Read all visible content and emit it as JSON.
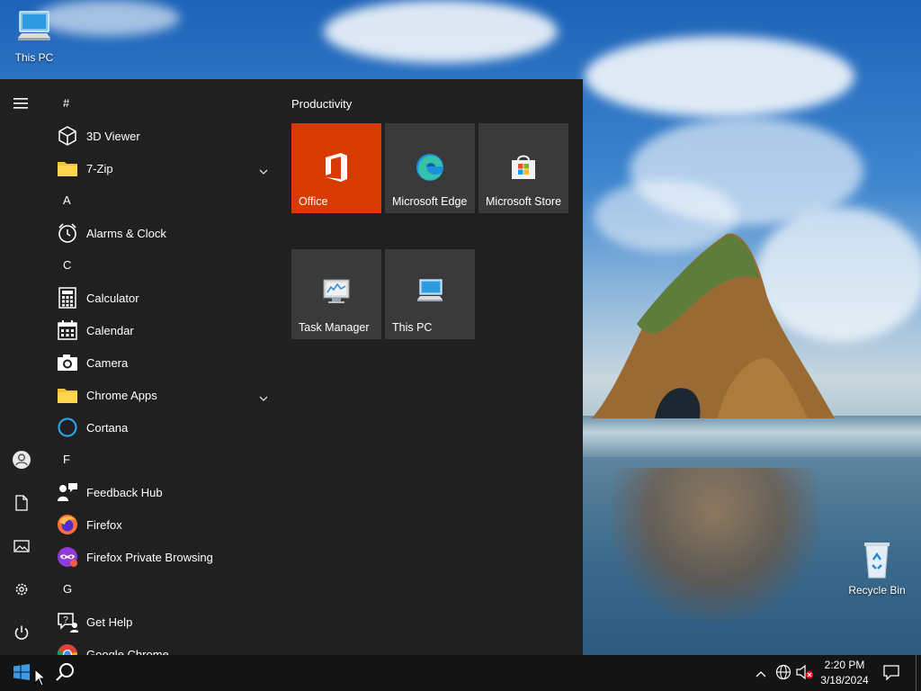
{
  "desktop": {
    "icons": [
      {
        "label": "This PC",
        "icon": "this-pc-icon"
      },
      {
        "label": "Recycle Bin",
        "icon": "recycle-bin-icon"
      }
    ]
  },
  "start_menu": {
    "rail": [
      "menu-icon",
      "user-icon",
      "documents-icon",
      "pictures-icon",
      "settings-icon",
      "power-icon"
    ],
    "groups": [
      {
        "letter": "#",
        "apps": [
          {
            "label": "3D Viewer",
            "icon": "3d-viewer-icon"
          },
          {
            "label": "7-Zip",
            "icon": "folder-icon",
            "expandable": true
          }
        ]
      },
      {
        "letter": "A",
        "apps": [
          {
            "label": "Alarms & Clock",
            "icon": "alarm-clock-icon"
          }
        ]
      },
      {
        "letter": "C",
        "apps": [
          {
            "label": "Calculator",
            "icon": "calculator-icon"
          },
          {
            "label": "Calendar",
            "icon": "calendar-icon"
          },
          {
            "label": "Camera",
            "icon": "camera-icon"
          },
          {
            "label": "Chrome Apps",
            "icon": "folder-icon",
            "expandable": true
          },
          {
            "label": "Cortana",
            "icon": "cortana-icon"
          }
        ]
      },
      {
        "letter": "F",
        "apps": [
          {
            "label": "Feedback Hub",
            "icon": "feedback-hub-icon"
          },
          {
            "label": "Firefox",
            "icon": "firefox-icon"
          },
          {
            "label": "Firefox Private Browsing",
            "icon": "firefox-private-icon"
          }
        ]
      },
      {
        "letter": "G",
        "apps": [
          {
            "label": "Get Help",
            "icon": "get-help-icon"
          },
          {
            "label": "Google Chrome",
            "icon": "chrome-icon"
          }
        ]
      }
    ],
    "tiles_group_title": "Productivity",
    "tiles": [
      {
        "label": "Office",
        "icon": "office-icon",
        "color": "#d83b01"
      },
      {
        "label": "Microsoft Edge",
        "icon": "edge-icon",
        "color": "#3a3a3a"
      },
      {
        "label": "Microsoft Store",
        "icon": "store-icon",
        "color": "#3a3a3a"
      },
      {
        "label": "Task Manager",
        "icon": "task-manager-icon",
        "color": "#3a3a3a"
      },
      {
        "label": "This PC",
        "icon": "this-pc-icon",
        "color": "#3a3a3a"
      }
    ]
  },
  "taskbar": {
    "start_icon": "windows-logo-icon",
    "search_icon": "search-icon",
    "tray_icons": [
      "chevron-up-icon",
      "network-icon",
      "volume-muted-icon"
    ],
    "time": "2:20 PM",
    "date": "3/18/2024",
    "notification_icon": "action-center-icon"
  },
  "colors": {
    "start_bg": "#202020",
    "taskbar_bg": "#141414",
    "office_tile": "#d83b01",
    "tile_bg": "#3a3a3a"
  }
}
